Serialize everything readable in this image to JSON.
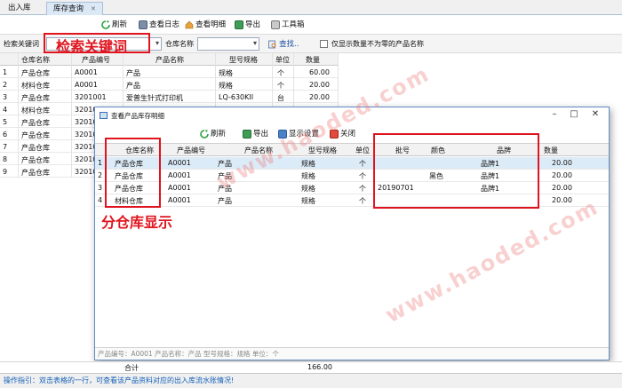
{
  "tabs": [
    {
      "label": "出入库"
    },
    {
      "label": "库存查询",
      "close": "✕"
    }
  ],
  "toolbar": {
    "refresh": "刷新",
    "view_log": "查看日志",
    "view_detail": "查看明细",
    "export": "导出",
    "toolbox": "工具箱"
  },
  "search": {
    "keyword_label": "检索关键词",
    "keyword_annotation": "检索关键词",
    "warehouse_label": "仓库名称",
    "warehouse_value": "",
    "find_button": "查找..",
    "nonzero_label": "仅显示数量不为零的产品名称"
  },
  "grid": {
    "headers": [
      "仓库名称",
      "产品编号",
      "产品名称",
      "型号规格",
      "单位",
      "数量"
    ],
    "rows": [
      {
        "n": "1",
        "warehouse": "产品仓库",
        "code": "A0001",
        "name": "产品",
        "spec": "规格",
        "unit": "个",
        "qty": "60.00"
      },
      {
        "n": "2",
        "warehouse": "材料仓库",
        "code": "A0001",
        "name": "产品",
        "spec": "规格",
        "unit": "个",
        "qty": "20.00"
      },
      {
        "n": "3",
        "warehouse": "产品仓库",
        "code": "3201001",
        "name": "爱普生针式打印机",
        "spec": "LQ-630KII",
        "unit": "台",
        "qty": "20.00"
      },
      {
        "n": "4",
        "warehouse": "材料仓库",
        "code": "32010",
        "name": "",
        "spec": "",
        "unit": "",
        "qty": ""
      },
      {
        "n": "5",
        "warehouse": "产品仓库",
        "code": "32010",
        "name": "",
        "spec": "",
        "unit": "",
        "qty": ""
      },
      {
        "n": "6",
        "warehouse": "产品仓库",
        "code": "32010",
        "name": "",
        "spec": "",
        "unit": "",
        "qty": ""
      },
      {
        "n": "7",
        "warehouse": "产品仓库",
        "code": "32010",
        "name": "",
        "spec": "",
        "unit": "",
        "qty": ""
      },
      {
        "n": "8",
        "warehouse": "产品仓库",
        "code": "32010",
        "name": "",
        "spec": "",
        "unit": "",
        "qty": ""
      },
      {
        "n": "9",
        "warehouse": "产品仓库",
        "code": "32010",
        "name": "",
        "spec": "",
        "unit": "",
        "qty": ""
      }
    ],
    "total_label": "合计",
    "total_value": "166.00"
  },
  "status": "操作指引：双击表格的一行，可查看该产品资料对应的出入库流水账情况!",
  "dialog": {
    "title": "查看产品库存明细",
    "toolbar": {
      "refresh": "刷新",
      "export": "导出",
      "display": "显示设置",
      "close": "关闭"
    },
    "headers": [
      "仓库名称",
      "产品编号",
      "产品名称",
      "型号规格",
      "单位",
      "批号",
      "颜色",
      "品牌",
      "数量"
    ],
    "rows": [
      {
        "n": "1",
        "warehouse": "产品仓库",
        "code": "A0001",
        "name": "产品",
        "spec": "规格",
        "unit": "个",
        "batch": "",
        "color": "",
        "brand": "品牌1",
        "qty": "20.00"
      },
      {
        "n": "2",
        "warehouse": "产品仓库",
        "code": "A0001",
        "name": "产品",
        "spec": "规格",
        "unit": "个",
        "batch": "",
        "color": "黑色",
        "brand": "品牌1",
        "qty": "20.00"
      },
      {
        "n": "3",
        "warehouse": "产品仓库",
        "code": "A0001",
        "name": "产品",
        "spec": "规格",
        "unit": "个",
        "batch": "20190701",
        "color": "",
        "brand": "品牌1",
        "qty": "20.00"
      },
      {
        "n": "4",
        "warehouse": "材料仓库",
        "code": "A0001",
        "name": "产品",
        "spec": "规格",
        "unit": "个",
        "batch": "",
        "color": "",
        "brand": "",
        "qty": "20.00"
      }
    ],
    "footer": "产品编号：A0001  产品名称：产品  型号规格：规格  单位：个",
    "annotation": "分仓库显示"
  },
  "watermark": "www.haoded.com",
  "colors": {
    "annotation": "#e0141e",
    "status_text": "#1560b8",
    "selected_row": "#dcebf8"
  }
}
